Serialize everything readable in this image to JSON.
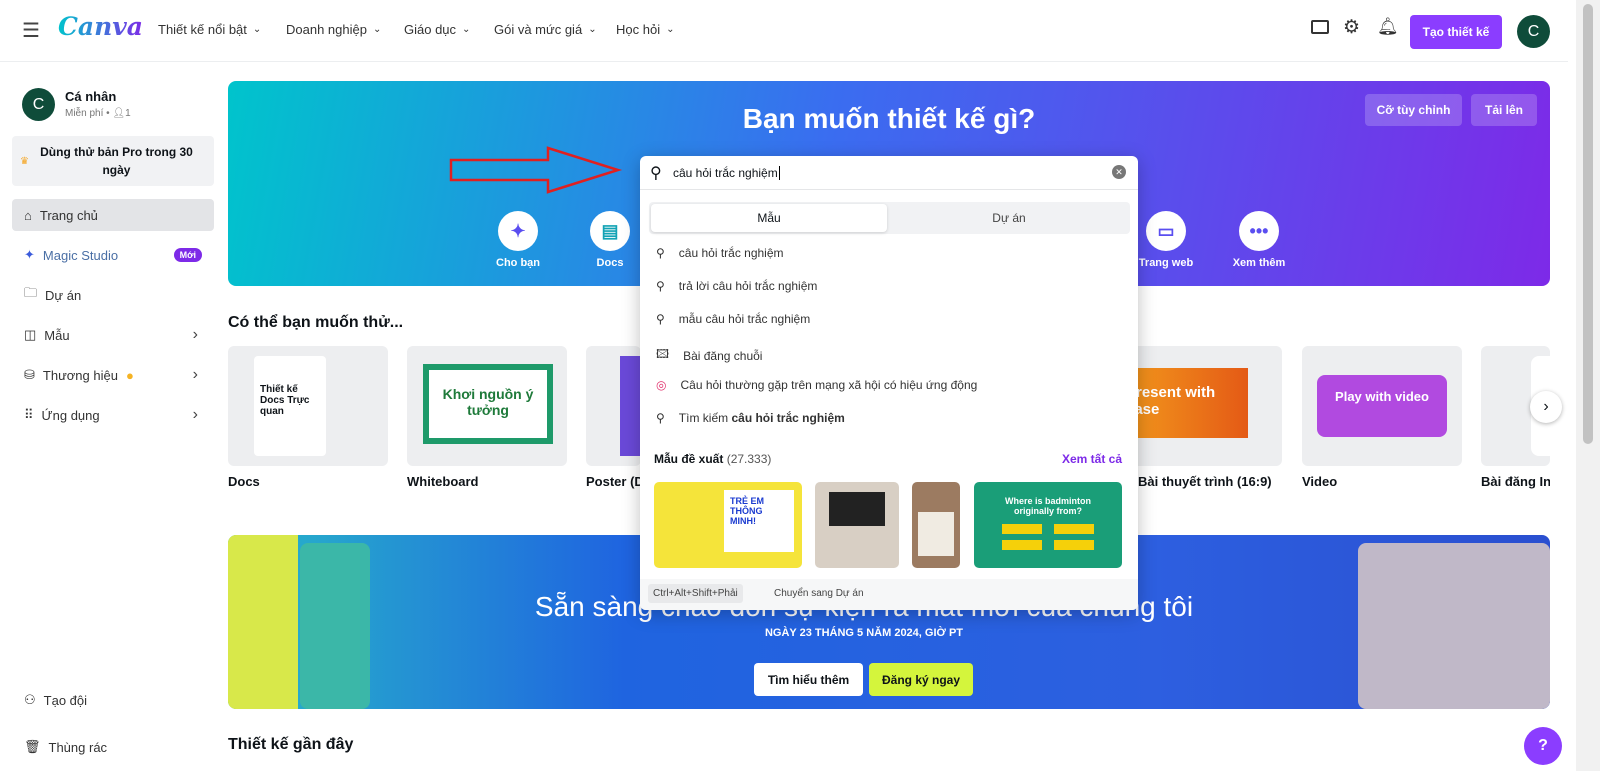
{
  "header": {
    "logo": "Canva",
    "nav": [
      "Thiết kế nổi bật",
      "Doanh nghiệp",
      "Giáo dục",
      "Gói và mức giá",
      "Học hỏi"
    ],
    "create_button": "Tạo thiết kế",
    "avatar_letter": "C"
  },
  "sidebar": {
    "account": {
      "letter": "C",
      "name": "Cá nhân",
      "plan": "Miễn phí •",
      "members": "1"
    },
    "pro_trial": "Dùng thử bản Pro trong 30 ngày",
    "items": [
      {
        "label": "Trang chủ",
        "icon": "home-icon"
      },
      {
        "label": "Magic Studio",
        "icon": "sparkle-icon",
        "badge": "Mới"
      },
      {
        "label": "Dự án",
        "icon": "folder-icon"
      },
      {
        "label": "Mẫu",
        "icon": "template-icon"
      },
      {
        "label": "Thương hiệu",
        "icon": "brand-icon"
      },
      {
        "label": "Ứng dụng",
        "icon": "apps-grid-icon"
      }
    ],
    "bottom": [
      {
        "label": "Tạo đội",
        "icon": "team-icon"
      },
      {
        "label": "Thùng rác",
        "icon": "trash-icon"
      }
    ]
  },
  "hero": {
    "title": "Bạn muốn thiết kế gì?",
    "custom_size": "Cỡ tùy chỉnh",
    "upload": "Tải lên",
    "categories": [
      "Cho bạn",
      "Docs",
      "Trang web",
      "Xem thêm"
    ]
  },
  "suggestions_section": {
    "title": "Có thể bạn muốn thử...",
    "cards": [
      "Docs",
      "Whiteboard",
      "Poster (Dọc)",
      "Bài thuyết trình (16:9)",
      "Video",
      "Bài đăng Instagram"
    ],
    "card_texts": {
      "docs": "Thiết kế Docs Trực quan",
      "whiteboard": "Khơi nguồn ý tưởng",
      "presentation": "Present with ease",
      "video": "Play with video"
    }
  },
  "banner": {
    "title": "Sẵn sàng chào đón sự kiện ra mắt mới của chúng tôi",
    "date": "NGÀY 23 THÁNG 5 NĂM 2024, GIỜ PT",
    "learn_more": "Tìm hiểu thêm",
    "register": "Đăng ký ngay"
  },
  "recent": {
    "title": "Thiết kế gần đây"
  },
  "search": {
    "value": "câu hỏi trắc nghiệm",
    "tabs": [
      "Mẫu",
      "Dự án"
    ],
    "active_tab": "Mẫu",
    "suggestions": [
      {
        "text": "câu hỏi trắc nghiệm",
        "icon": "search-icon"
      },
      {
        "text": "trả lời câu hỏi trắc nghiệm",
        "icon": "search-icon"
      },
      {
        "text": "mẫu câu hỏi trắc nghiệm",
        "icon": "search-icon"
      },
      {
        "text": "Bài đăng chuỗi",
        "icon": "image-icon"
      },
      {
        "text": "Câu hỏi thường gặp trên mạng xã hội có hiệu ứng động",
        "icon": "instagram-icon"
      },
      {
        "prefix": "Tìm kiếm ",
        "text": "câu hỏi trắc nghiệm",
        "icon": "search-icon"
      }
    ],
    "templates_label": "Mẫu đề xuất",
    "templates_count": "(27.333)",
    "see_all": "Xem tất cả",
    "template_texts": [
      "TRẺ EM THÔNG MINH!",
      "Where is badminton originally from?"
    ],
    "shortcut": "Ctrl+Alt+Shift+Phải",
    "shortcut_desc": "Chuyển sang Dự án"
  },
  "help": "?",
  "colors": {
    "accent": "#8b3dff",
    "hero_start": "#00c4cc",
    "hero_end": "#7d2ae8",
    "register_btn": "#d4f53c"
  }
}
